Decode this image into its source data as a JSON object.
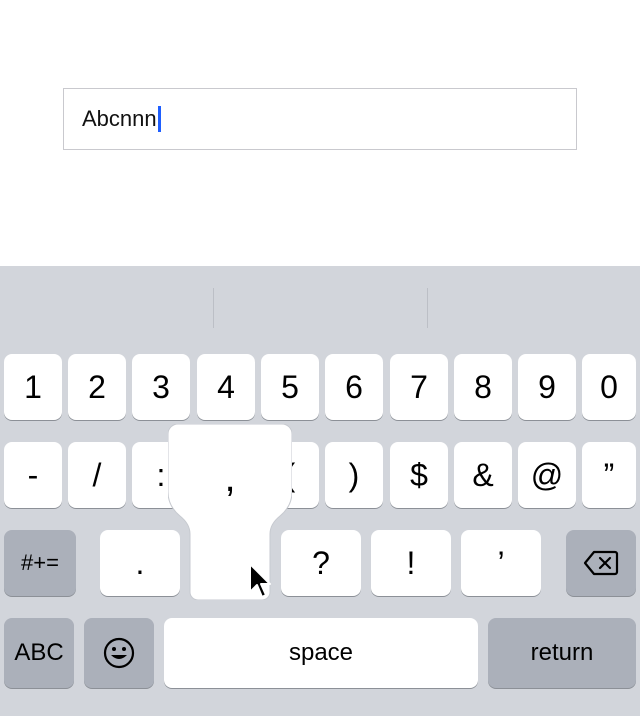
{
  "text_field": {
    "value": "Abcnnn"
  },
  "keyboard": {
    "row1": [
      "1",
      "2",
      "3",
      "4",
      "5",
      "6",
      "7",
      "8",
      "9",
      "0"
    ],
    "row2": [
      "-",
      "/",
      ":",
      ";",
      "(",
      ")",
      "$",
      "&",
      "@",
      "”"
    ],
    "row3": {
      "shift_label": "#+=",
      "keys": [
        ".",
        ",",
        "?",
        "!",
        "’"
      ],
      "delete_icon": "backspace-icon"
    },
    "row4": {
      "abc_label": "ABC",
      "emoji_icon": "emoji-icon",
      "space_label": "space",
      "return_label": "return"
    },
    "popup": {
      "label": ","
    }
  },
  "colors": {
    "keyboard_bg": "#d2d5db",
    "key_bg": "#ffffff",
    "dark_key_bg": "#abb0ba",
    "caret": "#1e5fff"
  }
}
